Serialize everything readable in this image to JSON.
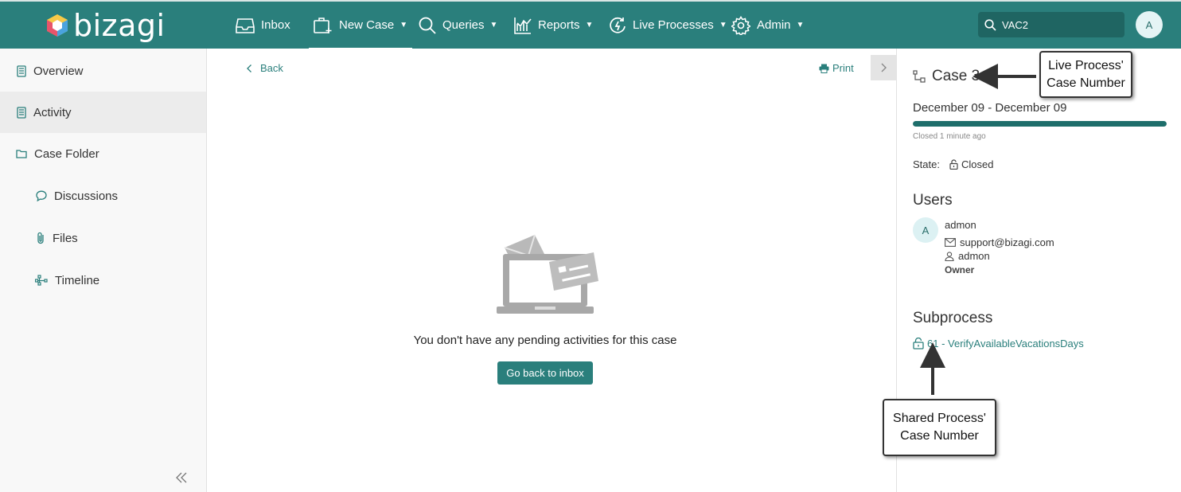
{
  "brand": {
    "name": "bizagi"
  },
  "nav": [
    {
      "label": "Inbox",
      "icon": "inbox-icon"
    },
    {
      "label": "New Case",
      "icon": "new-case-icon"
    },
    {
      "label": "Queries",
      "icon": "search-icon"
    },
    {
      "label": "Reports",
      "icon": "reports-icon"
    },
    {
      "label": "Live Processes",
      "icon": "live-processes-icon"
    },
    {
      "label": "Admin",
      "icon": "gear-icon"
    }
  ],
  "search": {
    "value": "VAC2"
  },
  "user_initial": "A",
  "sidebar": {
    "items": [
      {
        "label": "Overview",
        "icon": "document-icon"
      },
      {
        "label": "Activity",
        "icon": "document-icon"
      },
      {
        "label": "Case Folder",
        "icon": "folder-icon"
      },
      {
        "label": "Discussions",
        "icon": "chat-icon"
      },
      {
        "label": "Files",
        "icon": "paperclip-icon"
      },
      {
        "label": "Timeline",
        "icon": "timeline-icon"
      }
    ]
  },
  "main": {
    "back_label": "Back",
    "print_label": "Print",
    "empty_message": "You don't have any pending activities for this case",
    "go_back_label": "Go back to inbox"
  },
  "case": {
    "title": "Case 3",
    "dates": "December 09 - December 09",
    "progress": 1.0,
    "closed_ago": "Closed 1 minute ago",
    "state_label": "State:",
    "state_value": "Closed"
  },
  "users": {
    "title": "Users",
    "initial": "A",
    "name": "admon",
    "email": "support@bizagi.com",
    "username": "admon",
    "role": "Owner"
  },
  "subprocess": {
    "title": "Subprocess",
    "link": "61 - VerifyAvailableVacationsDays"
  },
  "callouts": {
    "live": {
      "line1": "Live Process'",
      "line2": "Case Number"
    },
    "shared": {
      "line1": "Shared Process'",
      "line2": "Case Number"
    }
  },
  "colors": {
    "topbar": "#2a7f7c",
    "accent": "#2a7f7c",
    "progress": "#1e6e6b"
  }
}
